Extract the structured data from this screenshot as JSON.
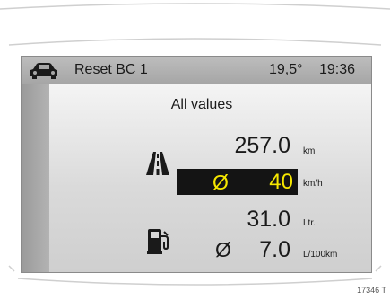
{
  "header": {
    "car_icon": "car-icon",
    "title": "Reset BC 1",
    "temperature": "19,5°",
    "time": "19:36"
  },
  "panel": {
    "subtitle": "All values",
    "rows": {
      "distance": {
        "icon": "road-icon",
        "value": "257.0",
        "unit": "km"
      },
      "avg_speed": {
        "symbol": "Ø",
        "value": "40",
        "unit": "km/h",
        "highlighted": true,
        "highlight_text_color": "#f5e600",
        "highlight_bg": "#141414"
      },
      "fuel_used": {
        "icon": "fuel-pump-icon",
        "value": "31.0",
        "unit": "Ltr."
      },
      "avg_consumption": {
        "symbol": "Ø",
        "value": "7.0",
        "unit": "L/100km"
      }
    }
  },
  "footer": {
    "figure_ref": "17346 T"
  },
  "colors": {
    "screen_bg": "#d2d2d2",
    "header_bg": "#a6a6a6",
    "text": "#1a1a1a"
  }
}
